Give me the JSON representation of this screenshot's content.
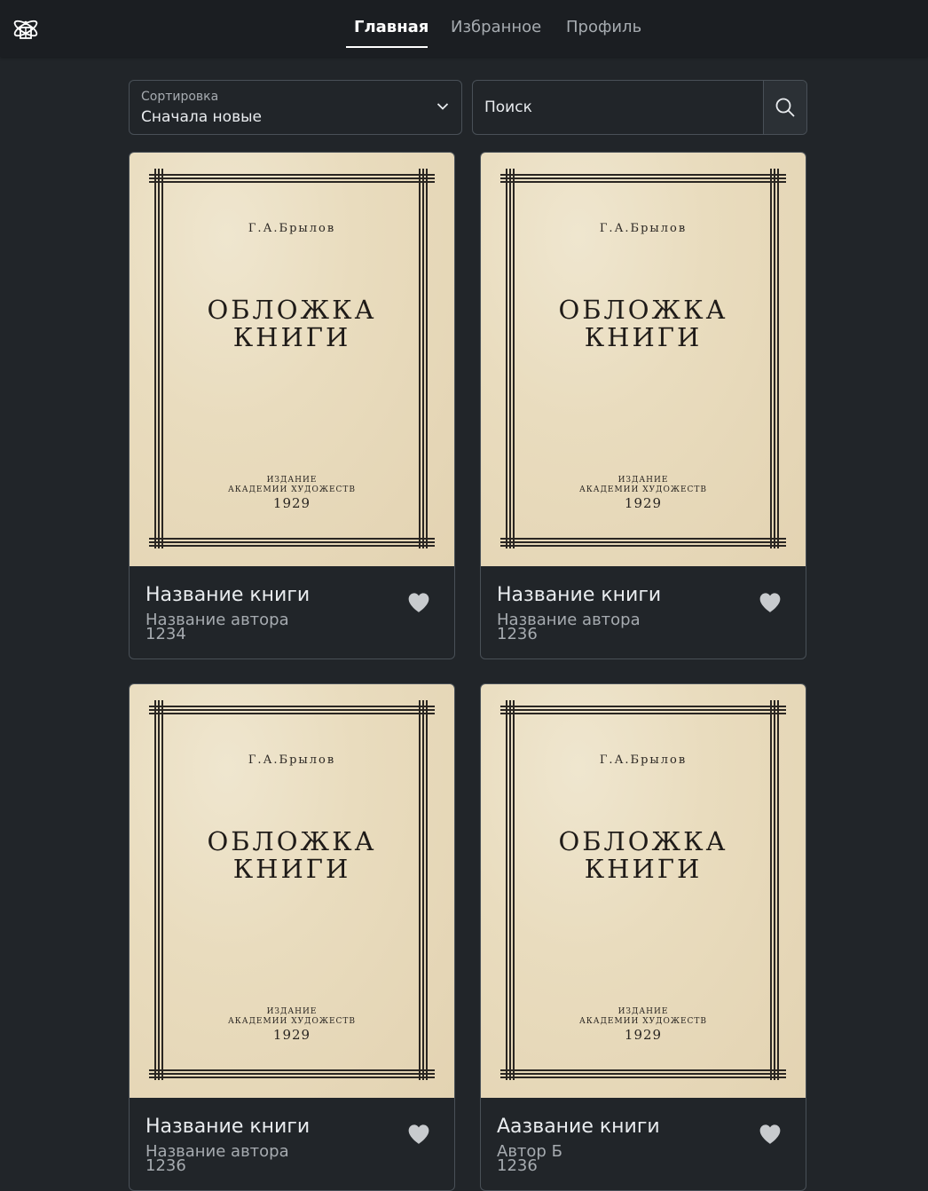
{
  "nav": {
    "items": [
      {
        "label": "Главная",
        "active": true
      },
      {
        "label": "Избранное",
        "active": false
      },
      {
        "label": "Профиль",
        "active": false
      }
    ]
  },
  "sort": {
    "label": "Сортировка",
    "value": "Сначала новые"
  },
  "search": {
    "placeholder": "Поиск"
  },
  "cover": {
    "author": "Г.А.Брылов",
    "title_line1": "ОБЛОЖКА",
    "title_line2": "КНИГИ",
    "pub_line1": "ИЗДАНИЕ",
    "pub_line2": "АКАДЕМИИ ХУДОЖЕСТВ",
    "year": "1929"
  },
  "books": [
    {
      "title": "Название книги",
      "author": "Название автора",
      "year": "1234"
    },
    {
      "title": "Название книги",
      "author": "Название автора",
      "year": "1236"
    },
    {
      "title": "Название книги",
      "author": "Название автора",
      "year": "1236"
    },
    {
      "title": "Аазвание книги",
      "author": "Автор Б",
      "year": "1236"
    }
  ],
  "colors": {
    "background": "#212529",
    "topbar": "#1b1e22",
    "border": "#495057",
    "heart": "#c8cbce"
  }
}
